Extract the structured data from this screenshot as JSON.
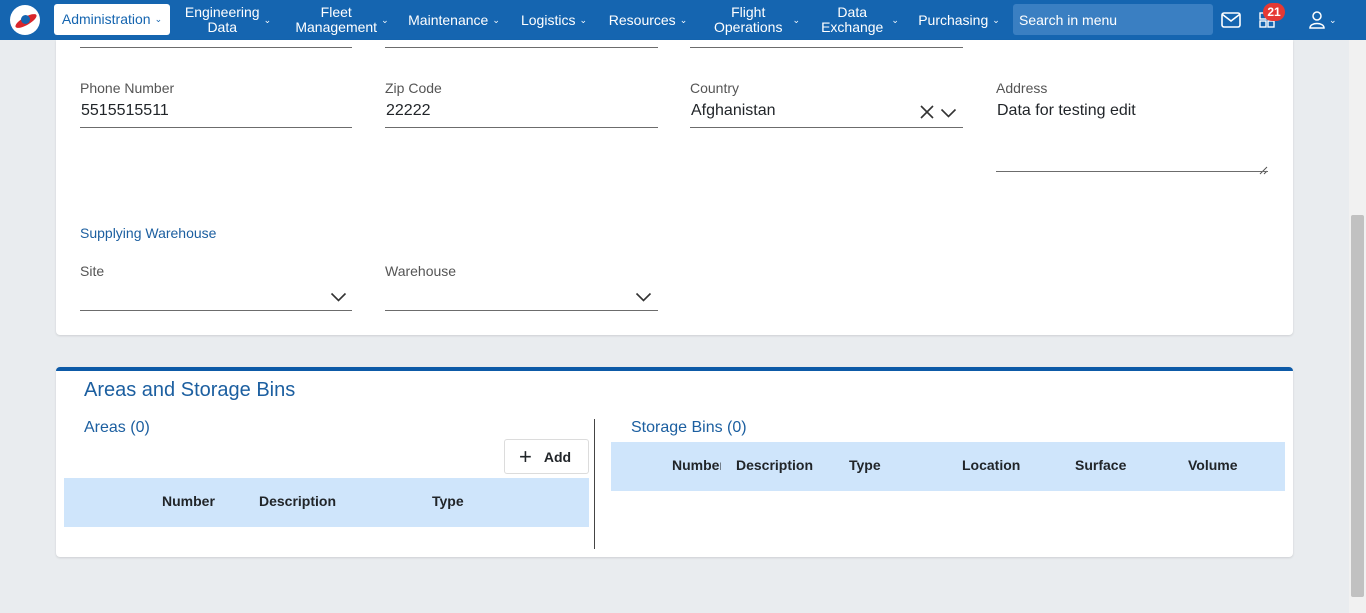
{
  "nav": {
    "items": [
      {
        "label": "Administration"
      },
      {
        "label": "Engineering Data",
        "line1": "Engineering",
        "line2": "Data"
      },
      {
        "label": "Fleet Management",
        "line1": "Fleet",
        "line2": "Management"
      },
      {
        "label": "Maintenance"
      },
      {
        "label": "Logistics"
      },
      {
        "label": "Resources"
      },
      {
        "label": "Flight Operations",
        "line1": "Flight",
        "line2": "Operations"
      },
      {
        "label": "Data Exchange",
        "line1": "Data",
        "line2": "Exchange"
      },
      {
        "label": "Purchasing"
      }
    ],
    "search_placeholder": "Search in menu",
    "notification_count": "21"
  },
  "form": {
    "phone_label": "Phone Number",
    "phone_value": "5515515511",
    "zip_label": "Zip Code",
    "zip_value": "22222",
    "country_label": "Country",
    "country_value": "Afghanistan",
    "address_label": "Address",
    "address_value": "Data for testing edit",
    "supplying_title": "Supplying Warehouse",
    "site_label": "Site",
    "site_value": "",
    "warehouse_label": "Warehouse",
    "warehouse_value": ""
  },
  "areas_section": {
    "title": "Areas and Storage Bins",
    "areas_title": "Areas (0)",
    "add_label": "Add",
    "areas_columns": [
      "Number",
      "Description",
      "Type"
    ],
    "bins_title": "Storage Bins (0)",
    "bins_columns": [
      "Number",
      "Description",
      "Type",
      "Location",
      "Surface",
      "Volume"
    ]
  },
  "colors": {
    "brand": "#1565b0",
    "header_row": "#cfe5fb",
    "badge": "#e53935"
  }
}
